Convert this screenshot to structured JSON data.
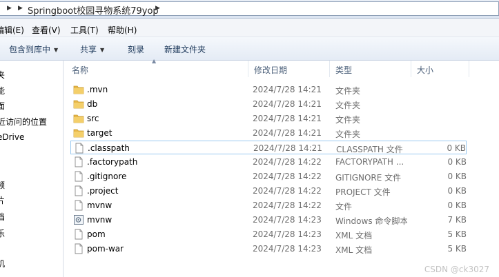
{
  "address_bar": {
    "path": "Springboot校园寻物系统79yop"
  },
  "menu": {
    "items": [
      {
        "label": "编辑(E)",
        "key": "edit"
      },
      {
        "label": "查看(V)",
        "key": "view"
      },
      {
        "label": "工具(T)",
        "key": "tools"
      },
      {
        "label": "帮助(H)",
        "key": "help"
      }
    ]
  },
  "commands": {
    "include_library": "包含到库中",
    "share": "共享",
    "burn": "刻录",
    "new_folder": "新建文件夹"
  },
  "nav": {
    "items": [
      "夹",
      "能",
      "面",
      "近访问的位置",
      "eDrive",
      "频",
      "片",
      "档",
      "乐",
      "机"
    ]
  },
  "columns": {
    "name": "名称",
    "modified": "修改日期",
    "type": "类型",
    "size": "大小"
  },
  "files": [
    {
      "name": ".mvn",
      "modified": "2024/7/28 14:21",
      "type": "文件夹",
      "size": "",
      "icon": "folder-icon"
    },
    {
      "name": "db",
      "modified": "2024/7/28 14:21",
      "type": "文件夹",
      "size": "",
      "icon": "folder-icon"
    },
    {
      "name": "src",
      "modified": "2024/7/28 14:21",
      "type": "文件夹",
      "size": "",
      "icon": "folder-icon"
    },
    {
      "name": "target",
      "modified": "2024/7/28 14:21",
      "type": "文件夹",
      "size": "",
      "icon": "folder-icon"
    },
    {
      "name": ".classpath",
      "modified": "2024/7/28 14:21",
      "type": "CLASSPATH 文件",
      "size": "0 KB",
      "icon": "file-icon",
      "selected": true
    },
    {
      "name": ".factorypath",
      "modified": "2024/7/28 14:22",
      "type": "FACTORYPATH ...",
      "size": "0 KB",
      "icon": "file-icon"
    },
    {
      "name": ".gitignore",
      "modified": "2024/7/28 14:22",
      "type": "GITIGNORE 文件",
      "size": "0 KB",
      "icon": "file-icon"
    },
    {
      "name": ".project",
      "modified": "2024/7/28 14:22",
      "type": "PROJECT 文件",
      "size": "0 KB",
      "icon": "file-icon"
    },
    {
      "name": "mvnw",
      "modified": "2024/7/28 14:22",
      "type": "文件",
      "size": "0 KB",
      "icon": "file-icon"
    },
    {
      "name": "mvnw",
      "modified": "2024/7/28 14:23",
      "type": "Windows 命令脚本",
      "size": "7 KB",
      "icon": "script-icon"
    },
    {
      "name": "pom",
      "modified": "2024/7/28 14:23",
      "type": "XML 文档",
      "size": "5 KB",
      "icon": "file-icon"
    },
    {
      "name": "pom-war",
      "modified": "2024/7/28 14:23",
      "type": "XML 文档",
      "size": "5 KB",
      "icon": "file-icon"
    }
  ],
  "watermark": "CSDN @ck3027",
  "colors": {
    "folder": "#e8b84a",
    "selection_border": "#99c9ef",
    "header_text": "#4c607a"
  }
}
